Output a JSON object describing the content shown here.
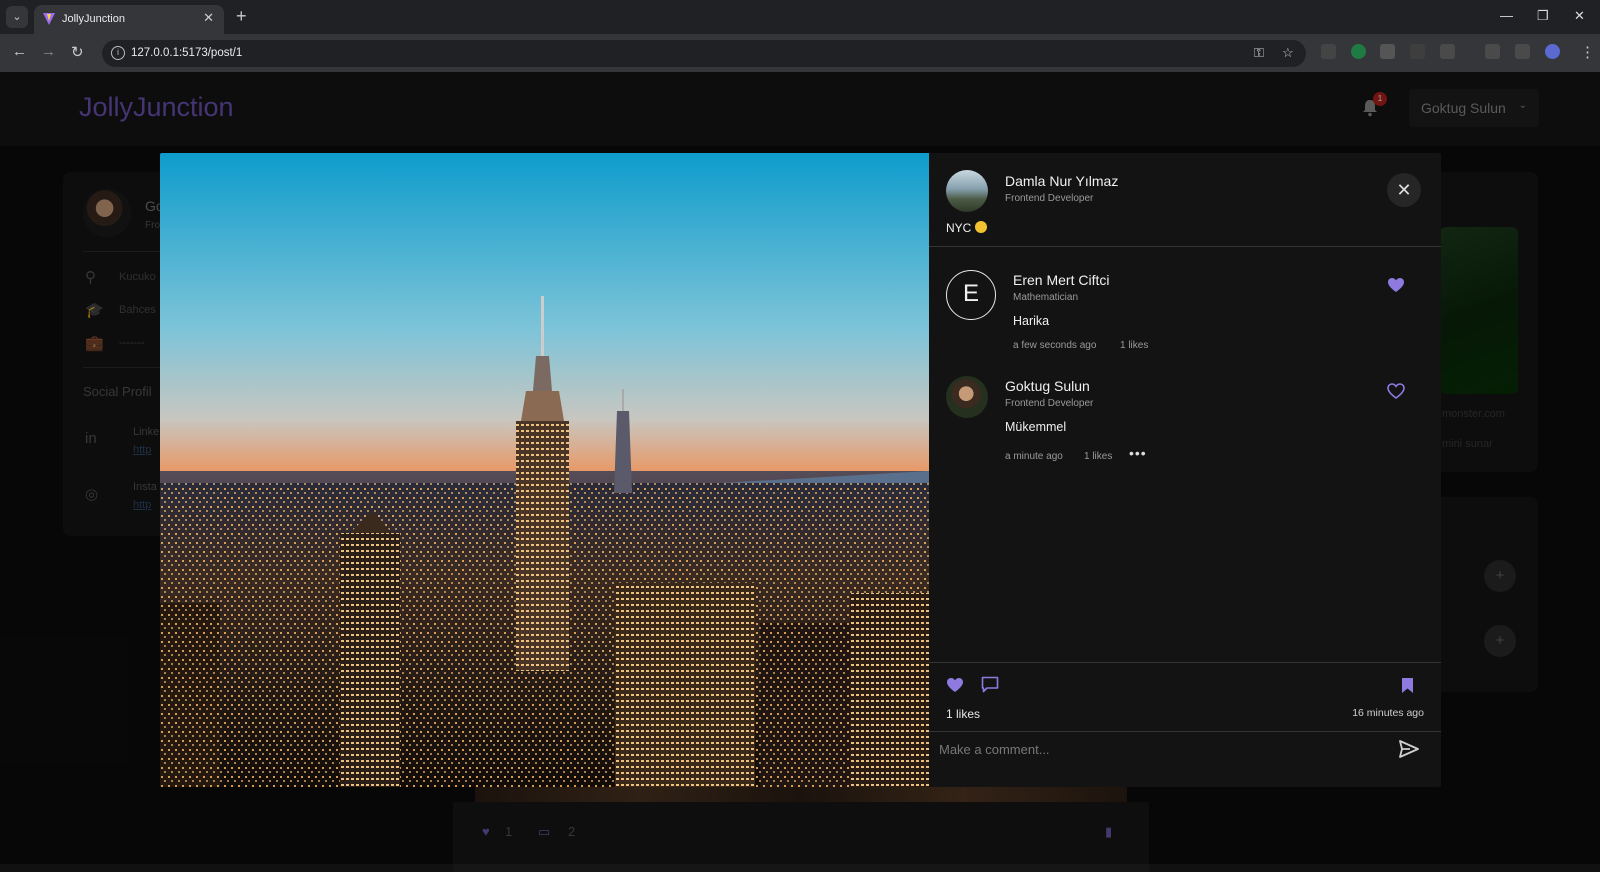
{
  "browser": {
    "tab_title": "JollyJunction",
    "url": "127.0.0.1:5173/post/1"
  },
  "app": {
    "brand": "JollyJunction",
    "notification_count": "1",
    "user_menu_label": "Goktug Sulun"
  },
  "background": {
    "profile": {
      "name": "Go",
      "role": "Fro",
      "location": "Kucuko",
      "education": "Bahces",
      "job": "-------",
      "social_title": "Social Profil",
      "linkedin_title": "Linke",
      "linkedin_url": "http",
      "instagram_title": "Insta",
      "instagram_url": "http"
    },
    "sponsored": {
      "site": "monster.com",
      "text": "mini sunar"
    },
    "feed": {
      "likes": "1",
      "comments": "2"
    }
  },
  "post": {
    "author_name": "Damla Nur Yılmaz",
    "author_role": "Frontend Developer",
    "caption": "NYC",
    "likes_label": "1 likes",
    "time_ago": "16 minutes ago",
    "comment_placeholder": "Make a comment...",
    "accent_color": "#8f7ae0"
  },
  "comments": [
    {
      "avatar_letter": "E",
      "name": "Eren Mert Ciftci",
      "role": "Mathematician",
      "text": "Harika",
      "time": "a few seconds ago",
      "likes": "1 likes",
      "liked": true
    },
    {
      "name": "Goktug Sulun",
      "role": "Frontend Developer",
      "text": "Mükemmel",
      "time": "a minute ago",
      "likes": "1 likes",
      "liked": false
    }
  ]
}
